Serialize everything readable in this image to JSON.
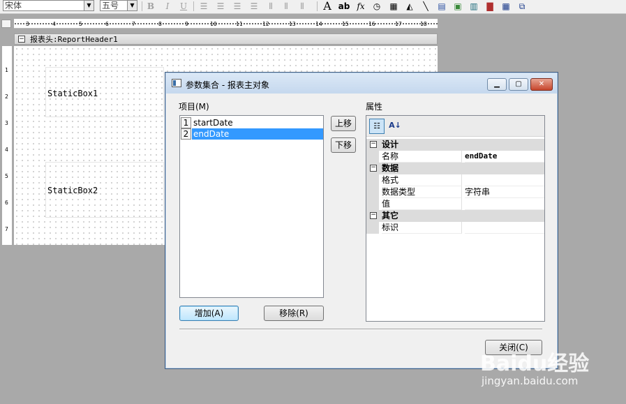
{
  "toolbar": {
    "font_name": "宋体",
    "font_size": "五号",
    "bold": "B",
    "italic": "I",
    "underline": "U",
    "text_tool": "A",
    "ab_tool": "ab",
    "fx_tool": "fx"
  },
  "ruler": {
    "h_ticks": [
      "3",
      "4",
      "5",
      "6",
      "7",
      "8",
      "9",
      "10",
      "11",
      "12",
      "13",
      "14",
      "15",
      "16",
      "17",
      "18"
    ],
    "v_ticks": [
      "1",
      "2",
      "3",
      "4",
      "5",
      "6",
      "7"
    ]
  },
  "report": {
    "section_title": "报表头:ReportHeader1",
    "box1_label": "StaticBox1",
    "box2_label": "StaticBox2"
  },
  "dialog": {
    "title": "参数集合 - 报表主对象",
    "items_label": "项目(M)",
    "properties_label": "属性",
    "items": [
      {
        "index": "1",
        "name": "startDate",
        "selected": false
      },
      {
        "index": "2",
        "name": "endDate",
        "selected": true
      }
    ],
    "move_up": "上移",
    "move_down": "下移",
    "add_button": "增加(A)",
    "remove_button": "移除(R)",
    "close_button": "关闭(C)",
    "property_grid": {
      "cat_design": "设计",
      "prop_name_label": "名称",
      "prop_name_value": "endDate",
      "cat_data": "数据",
      "prop_format_label": "格式",
      "prop_format_value": "",
      "prop_type_label": "数据类型",
      "prop_type_value": "字符串",
      "prop_value_label": "值",
      "prop_value_value": "",
      "cat_other": "其它",
      "prop_id_label": "标识",
      "prop_id_value": ""
    }
  },
  "watermark": {
    "brand": "Baidu经验",
    "url": "jingyan.baidu.com"
  }
}
